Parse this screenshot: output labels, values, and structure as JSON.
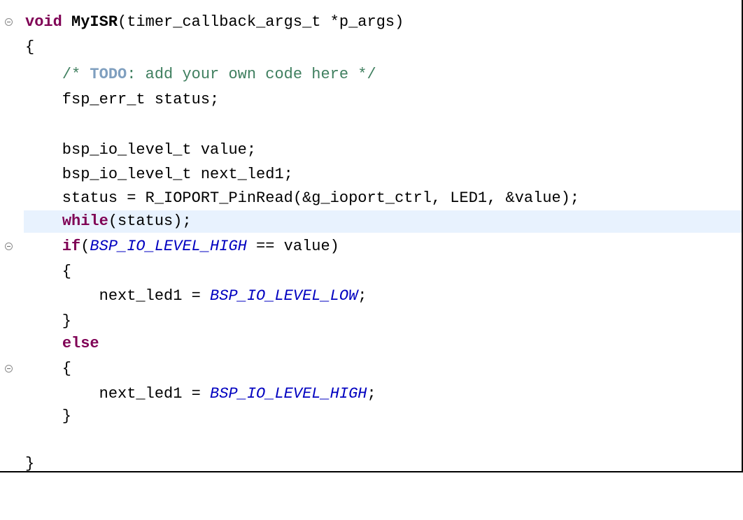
{
  "editor": {
    "lines": [
      {
        "kw": "void",
        "fn": "MyISR",
        "rest": "(timer_callback_args_t *p_args)"
      },
      {
        "text": "{"
      },
      {
        "indent": "    ",
        "cm1": "/* ",
        "todo": "TODO",
        "cm2": ": add your own code here */"
      },
      {
        "text": "    fsp_err_t status;"
      },
      {
        "text": ""
      },
      {
        "text": "    bsp_io_level_t value;"
      },
      {
        "text": "    bsp_io_level_t next_led1;"
      },
      {
        "text": "    status = R_IOPORT_PinRead(&g_ioport_ctrl, LED1, &value);"
      },
      {
        "indent": "    ",
        "kw": "while",
        "rest": "(status);"
      },
      {
        "indent": "    ",
        "kw": "if",
        "p1": "(",
        "mc": "BSP_IO_LEVEL_HIGH",
        "rest": " == value)"
      },
      {
        "text": "    {"
      },
      {
        "pre": "        next_led1 = ",
        "mc": "BSP_IO_LEVEL_LOW",
        "post": ";"
      },
      {
        "text": "    }"
      },
      {
        "indent": "    ",
        "kw": "else"
      },
      {
        "text": "    {"
      },
      {
        "pre": "        next_led1 = ",
        "mc": "BSP_IO_LEVEL_HIGH",
        "post": ";"
      },
      {
        "text": "    }"
      },
      {
        "text": ""
      },
      {
        "text": "}"
      }
    ]
  }
}
